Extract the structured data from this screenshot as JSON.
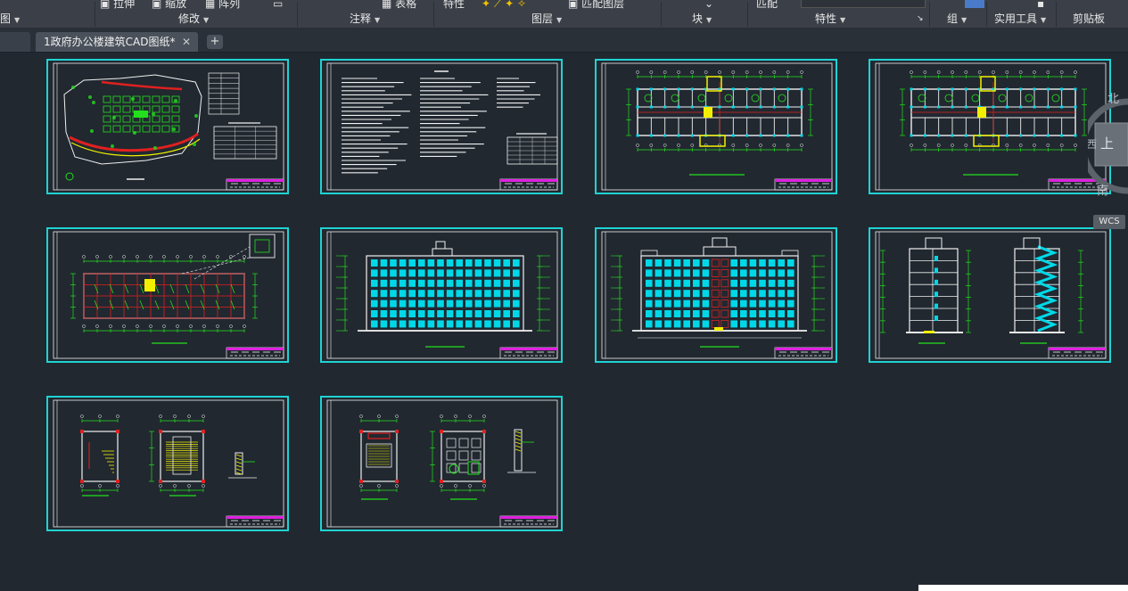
{
  "ribbon": {
    "panels": [
      {
        "name": "draw",
        "label": "图",
        "arrow": "▼"
      },
      {
        "name": "modify",
        "label": "修改",
        "arrow": "▼"
      },
      {
        "name": "annotation",
        "label": "注释",
        "arrow": "▼"
      },
      {
        "name": "layers",
        "label": "图层",
        "arrow": "▼"
      },
      {
        "name": "block",
        "label": "块",
        "arrow": "▼"
      },
      {
        "name": "properties",
        "label": "特性",
        "arrow": "▼"
      },
      {
        "name": "groups",
        "label": "组",
        "arrow": "▼"
      },
      {
        "name": "utilities",
        "label": "实用工具",
        "arrow": "▼"
      },
      {
        "name": "clipboard",
        "label": "剪贴板",
        "arrow": ""
      }
    ],
    "cut_labels": {
      "stretch": "拉伸",
      "scale": "缩放",
      "array": "阵列",
      "table": "表格",
      "properties": "特性",
      "layer_match": "匹配图层",
      "match": "匹配"
    },
    "properties_launcher": "↘"
  },
  "tabs": {
    "active_title": "1政府办公楼建筑CAD图纸*",
    "close_glyph": "✕",
    "new_tab_glyph": "+"
  },
  "viewcube": {
    "north": "北",
    "top": "上",
    "west": "西",
    "south": "南",
    "wcs": "WCS"
  },
  "colors": {
    "background": "#212830",
    "sheet_border": "#1fd3d3",
    "green": "#23e01e",
    "cyan": "#00d8e8",
    "red": "#e02020",
    "yellow": "#f2f000",
    "magenta": "#e020e0",
    "white": "#f0f0f0"
  },
  "sheets": [
    {
      "name": "site-plan",
      "type": "site"
    },
    {
      "name": "design-notes",
      "type": "notes"
    },
    {
      "name": "floor-plan-1",
      "type": "plan"
    },
    {
      "name": "floor-plan-2",
      "type": "plan"
    },
    {
      "name": "roof-plan",
      "type": "roof"
    },
    {
      "name": "front-elevation",
      "type": "elevation"
    },
    {
      "name": "rear-elevation",
      "type": "elevation2"
    },
    {
      "name": "section",
      "type": "section"
    },
    {
      "name": "stair-detail-1",
      "type": "detail"
    },
    {
      "name": "stair-detail-2",
      "type": "detail2"
    }
  ]
}
